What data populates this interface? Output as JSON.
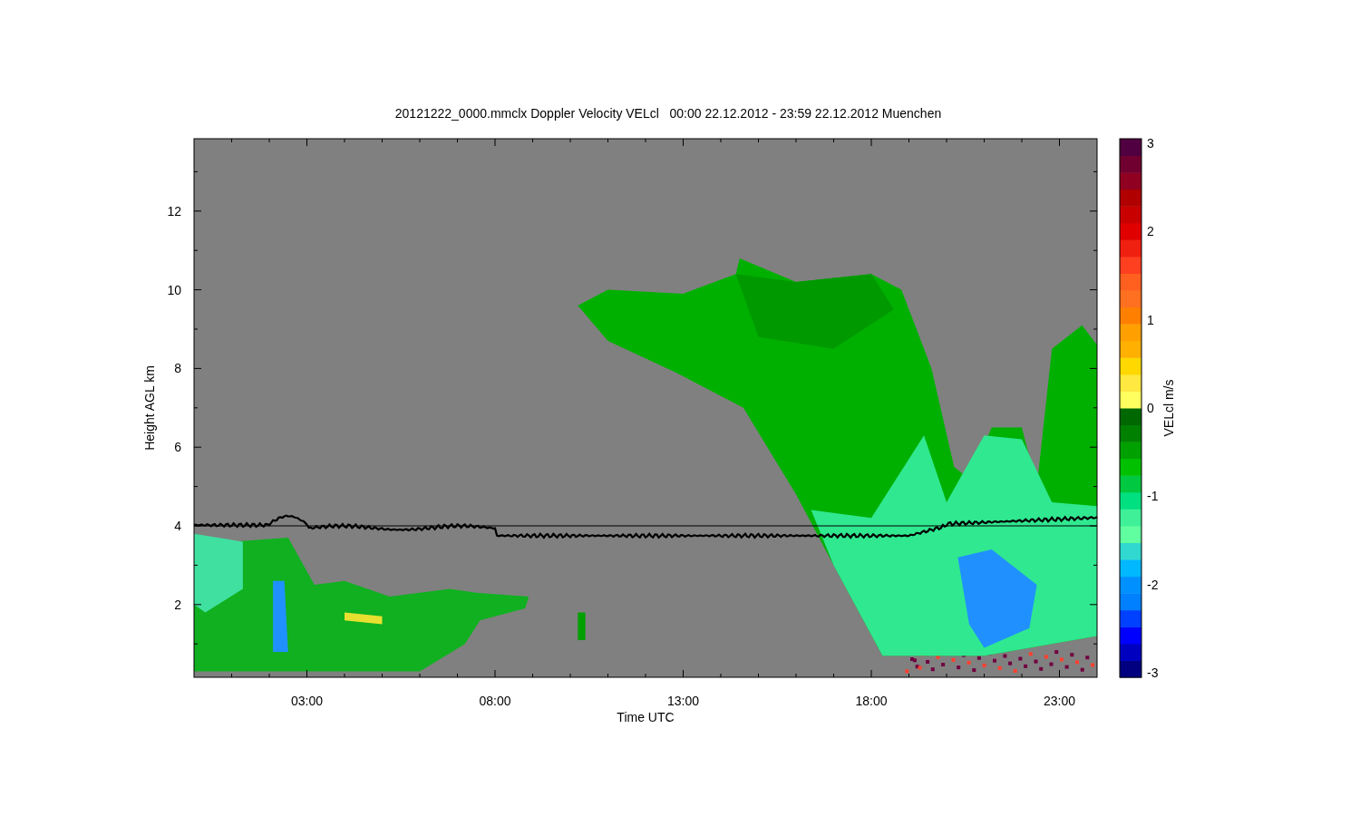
{
  "title": "20121222_0000.mmclx Doppler Velocity VELcl   00:00 22.12.2012 - 23:59 22.12.2012 Muenchen",
  "x_axis": {
    "label": "Time UTC",
    "ticks": [
      "03:00",
      "08:00",
      "13:00",
      "18:00",
      "23:00"
    ]
  },
  "y_axis": {
    "label": "Height AGL km",
    "ticks": [
      "12",
      "10",
      "8",
      "6",
      "4",
      "2"
    ]
  },
  "colorbar": {
    "label": "VELcl m/s",
    "ticks": [
      "3",
      "2",
      "1",
      "0",
      "-1",
      "-2",
      "-3"
    ]
  }
}
